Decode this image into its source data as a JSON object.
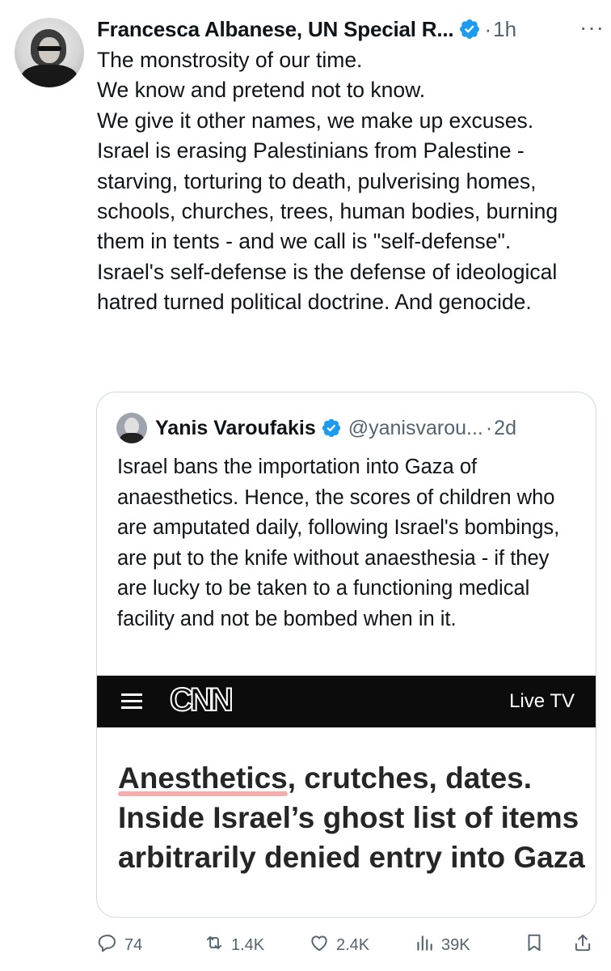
{
  "author": {
    "name": "Francesca Albanese, UN Special R...",
    "time": "1h",
    "dot": "·",
    "more": "···"
  },
  "tweet": {
    "lines": [
      "The monstrosity of our time.",
      "We know and pretend not to know.",
      "We give it other names, we make up excuses.",
      "Israel is erasing Palestinians from Palestine - starving, torturing to death, pulverising homes, schools, churches, trees, human bodies, burning them in tents - and we call is \"self-defense\".",
      "Israel's self-defense is the defense of ideological hatred turned political doctrine. And genocide."
    ]
  },
  "quote": {
    "name": "Yanis Varoufakis",
    "handle": "@yanisvarou...",
    "dot": "·",
    "time": "2d",
    "text": "Israel bans the importation into Gaza of anaesthetics. Hence, the scores of children who are amputated daily, following Israel's bombings, are put to the knife without anaesthesia - if they are lucky to be taken to a functioning medical facility and not be bombed when in it.",
    "media": {
      "logo": "CNN",
      "live_tv": "Live TV",
      "headline_highlight": "Anesthetics",
      "headline_rest": ", crutches, dates. Inside Israel’s ghost list of items arbitrarily denied entry into Gaza"
    }
  },
  "actions": {
    "replies": "74",
    "reposts": "1.4K",
    "likes": "2.4K",
    "views": "39K"
  },
  "colors": {
    "verified": "#1d9bf0",
    "secondary_text": "#536471",
    "highlight": "#f2a0a0"
  }
}
